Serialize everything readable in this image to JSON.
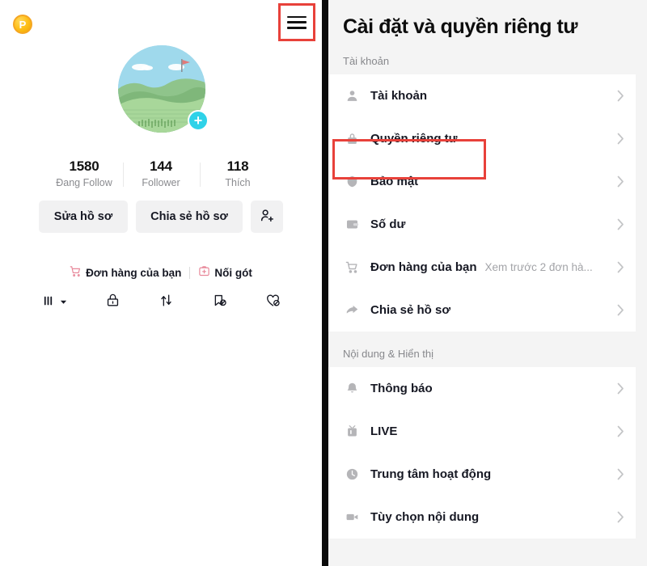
{
  "profile": {
    "coin_badge": {
      "label": "P",
      "icon": "coin-p-icon",
      "color": "#f5a623"
    },
    "menu_icon": "hamburger-menu-icon",
    "avatar": {
      "icon": "avatar-landscape-image",
      "add_label": "+"
    },
    "stats": [
      {
        "value": "1580",
        "label": "Đang Follow"
      },
      {
        "value": "144",
        "label": "Follower"
      },
      {
        "value": "118",
        "label": "Thích"
      }
    ],
    "buttons": {
      "edit_profile": "Sửa hồ sơ",
      "share_profile": "Chia sẻ hồ sơ",
      "add_friend_icon": "add-person-icon"
    },
    "links": [
      {
        "label": "Đơn hàng của bạn",
        "icon": "shopping-cart-icon"
      },
      {
        "label": "Nối gót",
        "icon": "add-box-icon"
      }
    ],
    "tabs": [
      {
        "icon": "grid-bars-icon",
        "label": ""
      },
      {
        "icon": "lock-private-icon",
        "label": ""
      },
      {
        "icon": "repost-arrows-icon",
        "label": ""
      },
      {
        "icon": "bookmark-hidden-icon",
        "label": ""
      },
      {
        "icon": "heart-hidden-icon",
        "label": ""
      }
    ]
  },
  "settings": {
    "title": "Cài đặt và quyền riêng tư",
    "sections": [
      {
        "header": "Tài khoản",
        "rows": [
          {
            "label": "Tài khoản",
            "sub": "",
            "icon": "person-icon",
            "highlighted": false
          },
          {
            "label": "Quyền riêng tư",
            "sub": "",
            "icon": "lock-icon",
            "highlighted": true
          },
          {
            "label": "Bảo mật",
            "sub": "",
            "icon": "shield-icon",
            "highlighted": false
          },
          {
            "label": "Số dư",
            "sub": "",
            "icon": "wallet-icon",
            "highlighted": false
          },
          {
            "label": "Đơn hàng của bạn",
            "sub": "Xem trước 2 đơn hà...",
            "icon": "cart-icon",
            "highlighted": false
          },
          {
            "label": "Chia sẻ hồ sơ",
            "sub": "",
            "icon": "share-arrow-icon",
            "highlighted": false
          }
        ]
      },
      {
        "header": "Nội dung & Hiển thị",
        "rows": [
          {
            "label": "Thông báo",
            "sub": "",
            "icon": "bell-icon",
            "highlighted": false
          },
          {
            "label": "LIVE",
            "sub": "",
            "icon": "live-tv-icon",
            "highlighted": false
          },
          {
            "label": "Trung tâm hoạt động",
            "sub": "",
            "icon": "clock-icon",
            "highlighted": false
          },
          {
            "label": "Tùy chọn nội dung",
            "sub": "",
            "icon": "video-camera-icon",
            "highlighted": false
          }
        ]
      }
    ],
    "chevron_icon": "chevron-right-icon",
    "highlight_color": "#e8413a"
  }
}
